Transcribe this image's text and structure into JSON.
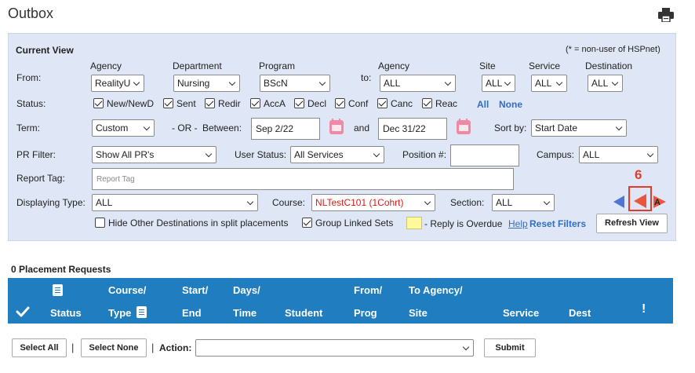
{
  "page": {
    "title": "Outbox",
    "print_icon": "printer-icon"
  },
  "panel": {
    "current_view": "Current View",
    "non_user_note": "(* = non-user of HSPnet)",
    "from": {
      "label": "From:",
      "agency_label": "Agency",
      "agency": "RealityU",
      "department_label": "Department",
      "department": "Nursing",
      "program_label": "Program",
      "program": "BScN"
    },
    "to": {
      "label": "to:",
      "agency_label": "Agency",
      "agency": "ALL",
      "site_label": "Site",
      "site": "ALL",
      "service_label": "Service",
      "service": "ALL",
      "destination_label": "Destination",
      "destination": "ALL"
    },
    "status": {
      "label": "Status:",
      "items": [
        {
          "label": "New/NewD",
          "checked": true
        },
        {
          "label": "Sent",
          "checked": true
        },
        {
          "label": "Redir",
          "checked": true
        },
        {
          "label": "AccA",
          "checked": true
        },
        {
          "label": "Decl",
          "checked": true
        },
        {
          "label": "Conf",
          "checked": true
        },
        {
          "label": "Canc",
          "checked": true
        },
        {
          "label": "Reac",
          "checked": true
        }
      ],
      "all_link": "All",
      "none_link": "None"
    },
    "term": {
      "label": "Term:",
      "value": "Custom",
      "or_text": "- OR -",
      "between_label": "Between:",
      "start": "Sep 2/22",
      "and_label": "and",
      "end": "Dec 31/22",
      "sort_label": "Sort by:",
      "sort_value": "Start Date"
    },
    "pr_filter": {
      "label": "PR Filter:",
      "value": "Show All PR's",
      "user_status_label": "User Status:",
      "user_status": "All Services",
      "position_label": "Position #:",
      "position_value": "",
      "campus_label": "Campus:",
      "campus": "ALL"
    },
    "report_tag": {
      "label": "Report Tag:",
      "placeholder": "Report Tag"
    },
    "displaying": {
      "label": "Displaying Type:",
      "value": "ALL",
      "course_label": "Course:",
      "course": "NLTestC101 (1Cohrt)",
      "section_label": "Section:",
      "section": "ALL"
    },
    "annotation_number": "6",
    "options": {
      "hide_other": {
        "label": "Hide Other Destinations in split placements",
        "checked": false
      },
      "group_linked": {
        "label": "Group Linked Sets",
        "checked": true
      },
      "overdue_text": "- Reply is Overdue",
      "help_link": "Help",
      "reset_link": "Reset Filters",
      "refresh_button": "Refresh View"
    },
    "colors": {
      "panel_bg": "#dfe6f5",
      "accent_blue": "#2f6fc6",
      "nav_red": "#e9573f",
      "nav_blue": "#4f74d6"
    }
  },
  "results": {
    "count_label": "0 Placement Requests"
  },
  "table": {
    "headers": {
      "status": "Status",
      "course_top": "Course/",
      "course_bottom": "Type",
      "start_top": "Start/",
      "start_bottom": "End",
      "days_top": "Days/",
      "days_bottom": "Time",
      "student": "Student",
      "from_top": "From/",
      "from_bottom": "Prog",
      "to_top": "To Agency/",
      "to_bottom": "Site",
      "service": "Service",
      "dest": "Dest",
      "alert": "!"
    },
    "header_bg": "#1f7dc0"
  },
  "footer": {
    "select_all": "Select All",
    "separator": "|",
    "select_none": "Select None",
    "action_label": "Action:",
    "action_value": "",
    "submit": "Submit"
  }
}
